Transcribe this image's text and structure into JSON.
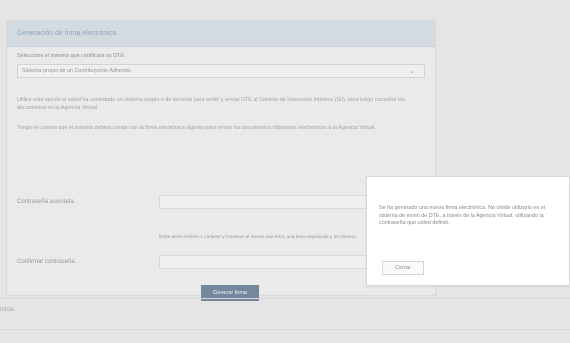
{
  "panel": {
    "title": "Generación de firma electrónica",
    "select_label": "Seleccione el sistema que certificará su DTE:",
    "select_value": "Sistema propio de un Contribuyente Adherido",
    "paragraph_1": "Utilice esta opción si usted ha contratado un sistema propio o de terceros para emitir y enviar DTE al Servicio de Impuestos Internos (SII), para luego consultar los documentos en la Agencia Virtual.",
    "paragraph_2": "Tenga en cuenta que el sistema deberá contar con la firma electrónica vigente para enviar los documentos tributarios electrónicos a la Agencia Virtual.",
    "password_label": "Contraseña asociada",
    "confirm_label": "Confirmar contraseña",
    "help_text": "Debe tener mínimo 1 carácter y contener al menos una letra, una letra mayúscula y un número.",
    "generate_button": "Generar firma",
    "footer_text": "Inicio"
  },
  "dialog": {
    "text": "Se ha generado una nueva firma electrónica. No olvide utilizarla en el sistema de envío de DTE, a través de la Agencia Virtual, utilizando la contraseña que usted definió.",
    "button": "Cerrar"
  }
}
